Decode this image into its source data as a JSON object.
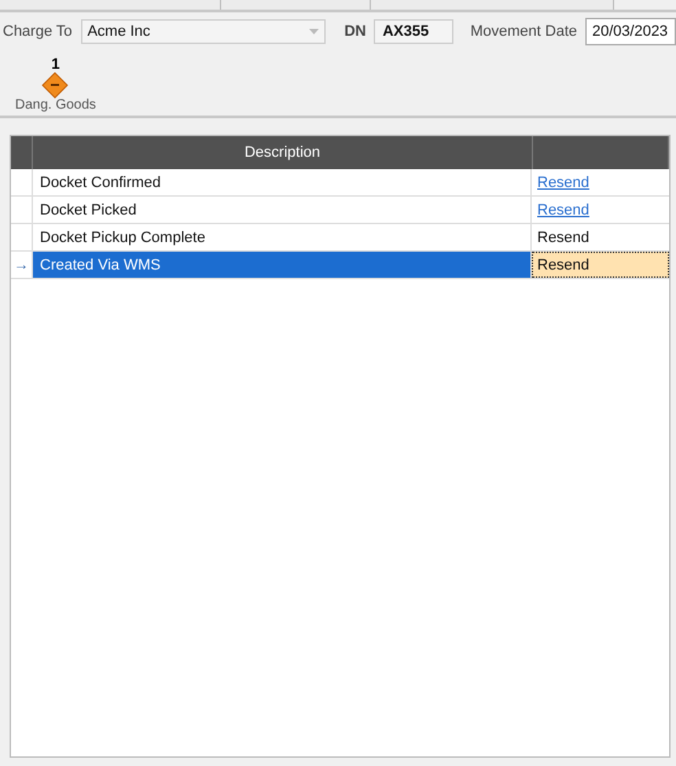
{
  "form": {
    "charge_to_label": "Charge To",
    "charge_to_value": "Acme Inc",
    "dn_label": "DN",
    "dn_value": "AX355",
    "movement_date_label": "Movement Date",
    "movement_date_value": "20/03/2023"
  },
  "dangerous_goods": {
    "count": "1",
    "label": "Dang. Goods"
  },
  "grid": {
    "columns": [
      "Description"
    ],
    "current_marker": "→",
    "rows": [
      {
        "description": "Docket Confirmed",
        "action": "Resend",
        "kind": "link",
        "selected": false
      },
      {
        "description": "Docket Picked",
        "action": "Resend",
        "kind": "link",
        "selected": false
      },
      {
        "description": "Docket Pickup Complete",
        "action": "Resend",
        "kind": "plain",
        "selected": false
      },
      {
        "description": "Created Via WMS",
        "action": "Resend",
        "kind": "plain",
        "selected": true
      }
    ]
  }
}
